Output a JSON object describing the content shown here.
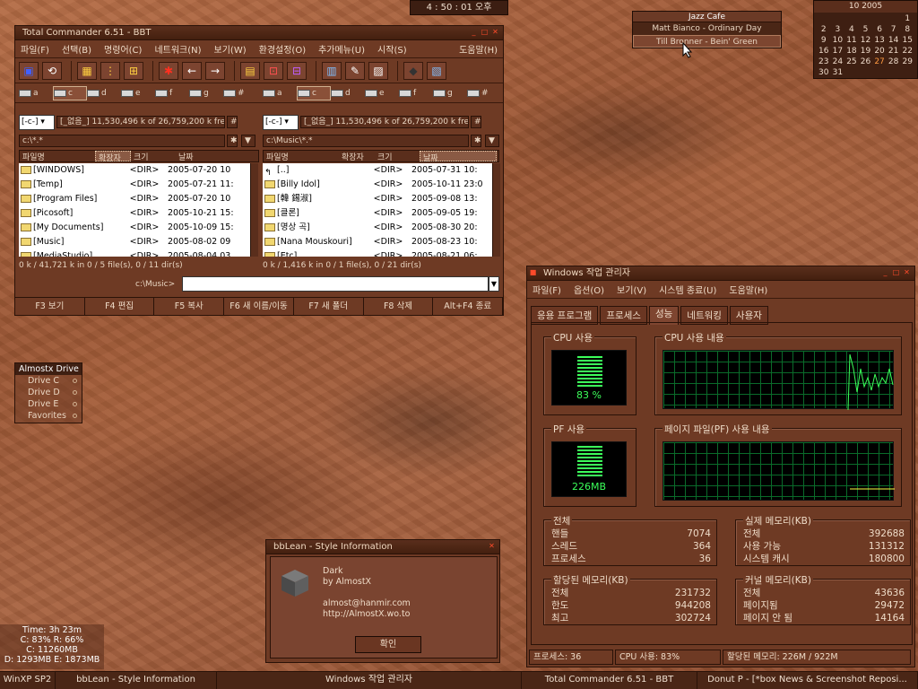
{
  "clock": {
    "time": "4 : 50 : 01  오후"
  },
  "music": {
    "title": "Jazz Cafe",
    "tracks": [
      "Matt Bianco - Ordinary Day",
      "Till Bronner - Bein' Green"
    ]
  },
  "calendar": {
    "header": "10  2005",
    "days": [
      [
        "",
        "",
        "",
        "",
        "",
        "",
        "1"
      ],
      [
        "2",
        "3",
        "4",
        "5",
        "6",
        "7",
        "8"
      ],
      [
        "9",
        "10",
        "11",
        "12",
        "13",
        "14",
        "15"
      ],
      [
        "16",
        "17",
        "18",
        "19",
        "20",
        "21",
        "22"
      ],
      [
        "23",
        "24",
        "25",
        "26",
        "27",
        "28",
        "29"
      ],
      [
        "30",
        "31",
        "",
        "",
        "",
        "",
        ""
      ]
    ],
    "today": "27"
  },
  "tc": {
    "title": "Total Commander 6.51 - BBT",
    "menu": [
      "파일(F)",
      "선택(B)",
      "명령어(C)",
      "네트워크(N)",
      "보기(W)",
      "환경설정(O)",
      "추가메뉴(U)",
      "시작(S)"
    ],
    "help": "도움말(H)",
    "left": {
      "drive": "[-c-]",
      "volume": "[_없음_]  11,530,496 k of 26,759,200 k free",
      "path": "c:\\*.*",
      "cols": [
        "파일명",
        "확장자",
        "크기",
        "날짜"
      ],
      "rows": [
        [
          "[WINDOWS]",
          "<DIR>",
          "2005-07-20 10"
        ],
        [
          "[Temp]",
          "<DIR>",
          "2005-07-21 11:"
        ],
        [
          "[Program Files]",
          "<DIR>",
          "2005-07-20 10"
        ],
        [
          "[Picosoft]",
          "<DIR>",
          "2005-10-21 15:"
        ],
        [
          "[My Documents]",
          "<DIR>",
          "2005-10-09 15:"
        ],
        [
          "[Music]",
          "<DIR>",
          "2005-08-02 09"
        ],
        [
          "[MediaStudio]",
          "<DIR>",
          "2005-08-04 03"
        ]
      ],
      "status": "0 k / 41,721 k in 0 / 5 file(s), 0 / 11 dir(s)"
    },
    "right": {
      "drive": "[-c-]",
      "volume": "[_없음_]  11,530,496 k of 26,759,200 k free",
      "path": "c:\\Music\\*.*",
      "cols": [
        "파일명",
        "확장자",
        "크기",
        "날짜"
      ],
      "rows": [
        [
          "[..]",
          "<DIR>",
          "2005-07-31 10:"
        ],
        [
          "[Billy Idol]",
          "<DIR>",
          "2005-10-11 23:0"
        ],
        [
          "[韓 錫淑]",
          "<DIR>",
          "2005-09-08 13:"
        ],
        [
          "[클론]",
          "<DIR>",
          "2005-09-05 19:"
        ],
        [
          "[명상 곡]",
          "<DIR>",
          "2005-08-30 20:"
        ],
        [
          "[Nana Mouskouri]",
          "<DIR>",
          "2005-08-23 10:"
        ],
        [
          "[Etc]",
          "<DIR>",
          "2005-08-21 06:"
        ]
      ],
      "status": "0 k / 1,416 k in 0 / 1 file(s), 0 / 21 dir(s)"
    },
    "cmd_label": "c:\\Music>",
    "fkeys": [
      "F3 보기",
      "F4 편집",
      "F5 복사",
      "F6 새 이름/이동",
      "F7 새 폴더",
      "F8 삭제",
      "Alt+F4 종료"
    ],
    "drives": [
      "a",
      "c",
      "d",
      "e",
      "f",
      "g",
      "#"
    ]
  },
  "drive_menu": {
    "title": "Almostx Drive",
    "items": [
      "Drive C",
      "Drive D",
      "Drive E",
      "Favorites"
    ]
  },
  "tm": {
    "title": "Windows 작업 관리자",
    "menu": [
      "파일(F)",
      "옵션(O)",
      "보기(V)",
      "시스템 종료(U)",
      "도움말(H)"
    ],
    "tabs": [
      "응용 프로그램",
      "프로세스",
      "성능",
      "네트워킹",
      "사용자"
    ],
    "cpu_label": "CPU 사용",
    "cpu_value": "83 %",
    "cpu_hist_label": "CPU 사용 내용",
    "pf_label": "PF 사용",
    "pf_value": "226MB",
    "pf_hist_label": "페이지 파일(PF) 사용 내용",
    "totals": {
      "label": "전체",
      "rows": [
        [
          "핸들",
          "7074"
        ],
        [
          "스레드",
          "364"
        ],
        [
          "프로세스",
          "36"
        ]
      ]
    },
    "physical": {
      "label": "실제 메모리(KB)",
      "rows": [
        [
          "전체",
          "392688"
        ],
        [
          "사용 가능",
          "131312"
        ],
        [
          "시스템 캐시",
          "180800"
        ]
      ]
    },
    "commit": {
      "label": "할당된 메모리(KB)",
      "rows": [
        [
          "전체",
          "231732"
        ],
        [
          "한도",
          "944208"
        ],
        [
          "최고",
          "302724"
        ]
      ]
    },
    "kernel": {
      "label": "커널 메모리(KB)",
      "rows": [
        [
          "전체",
          "43636"
        ],
        [
          "페이지됨",
          "29472"
        ],
        [
          "페이지 안 됨",
          "14164"
        ]
      ]
    },
    "status": [
      "프로세스: 36",
      "CPU 사용: 83%",
      "할당된 메모리: 226M / 922M"
    ]
  },
  "style_info": {
    "title": "bbLean - Style Information",
    "name": "Dark",
    "by": "by AlmostX",
    "email": "almost@hanmir.com",
    "url": "http://AlmostX.wo.to",
    "ok": "확인"
  },
  "sysinfo": [
    "Time: 3h 23m",
    "C: 83%    R: 66%",
    "C: 11260MB",
    "D: 1293MB  E: 1873MB"
  ],
  "taskbar": [
    "WinXP SP2",
    "bbLean - Style Information",
    "Windows 작업 관리자",
    "Total Commander 6.51 - BBT",
    "Donut P - [*box News & Screenshot Reposi..."
  ],
  "colors": {
    "accent": "#6e3a24",
    "green": "#2fd04a",
    "graph_grid": "#0a6b2a"
  }
}
